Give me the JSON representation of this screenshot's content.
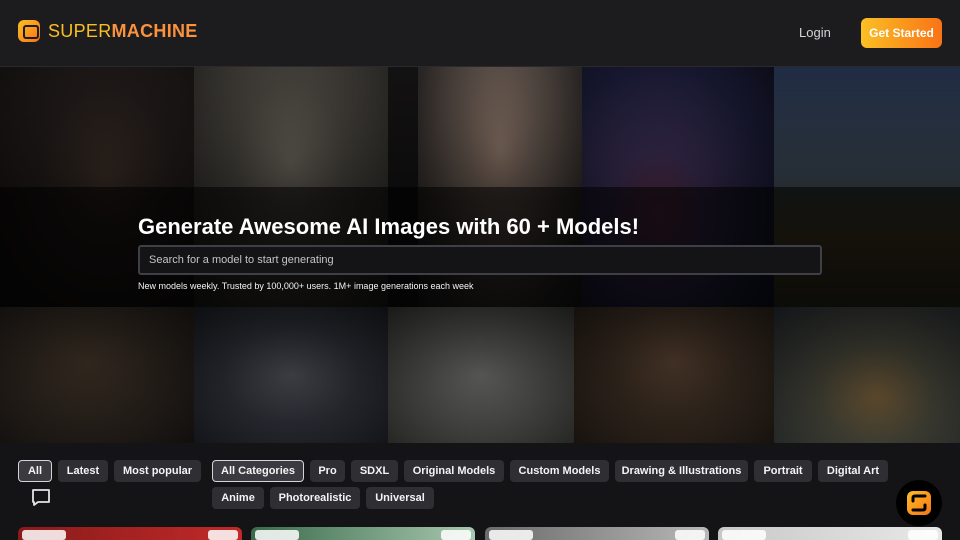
{
  "header": {
    "brand_light": "SUPER",
    "brand_bold": "MACHINE",
    "login_label": "Login",
    "get_started_label": "Get Started"
  },
  "hero": {
    "title": "Generate Awesome AI Images with 60 + Models!",
    "search_placeholder": "Search for a model to start generating",
    "subtitle": "New models weekly. Trusted by 100,000+ users. 1M+ image generations each week"
  },
  "filters": {
    "sort": [
      {
        "label": "All",
        "active": true
      },
      {
        "label": "Latest",
        "active": false
      },
      {
        "label": "Most popular",
        "active": false
      }
    ],
    "categories_row1": [
      {
        "label": "All Categories",
        "active": true
      },
      {
        "label": "Pro",
        "active": false
      },
      {
        "label": "SDXL",
        "active": false
      },
      {
        "label": "Original Models",
        "active": false
      },
      {
        "label": "Custom Models",
        "active": false
      },
      {
        "label": "Drawing & Illustrations",
        "active": false
      },
      {
        "label": "Portrait",
        "active": false
      },
      {
        "label": "Digital Art",
        "active": false
      }
    ],
    "categories_row2": [
      {
        "label": "Anime",
        "active": false
      },
      {
        "label": "Photorealistic",
        "active": false
      },
      {
        "label": "Universal",
        "active": false
      }
    ]
  },
  "icons": {
    "chat": "chat-bubble-icon",
    "brand": "supermachine-logo-icon"
  },
  "colors": {
    "accent_start": "#fbbf24",
    "accent_end": "#f97316",
    "background": "#141416",
    "chip": "#2e2e33"
  }
}
